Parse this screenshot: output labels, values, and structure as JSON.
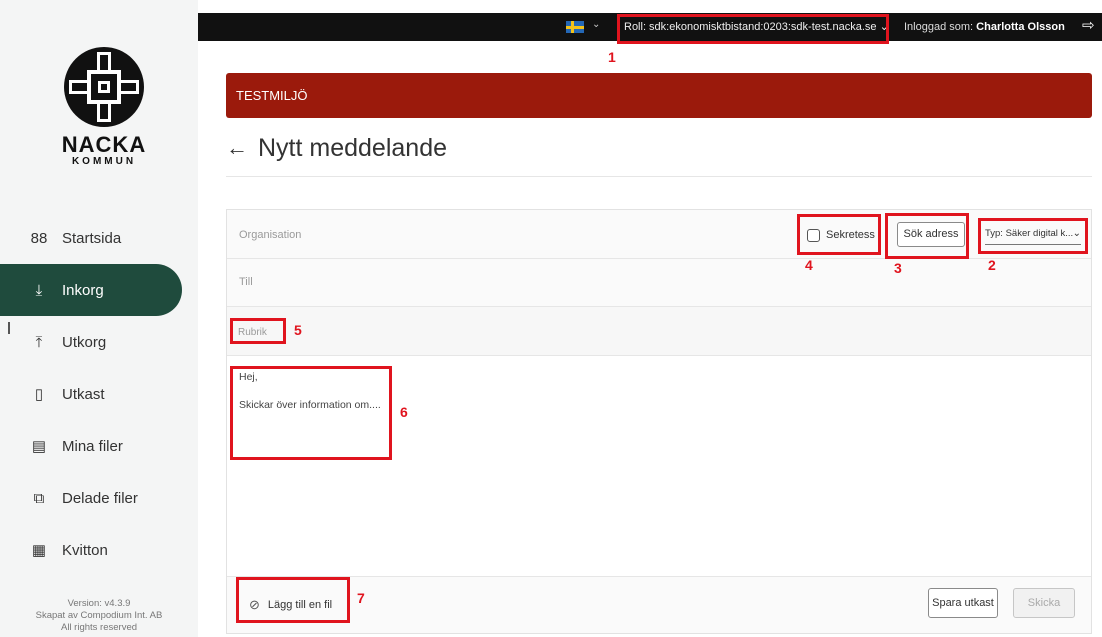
{
  "sidebar": {
    "logo": {
      "name": "NACKA",
      "sub": "KOMMUN"
    },
    "items": [
      {
        "label": "Startsida",
        "icon": "grid-icon",
        "glyph": "88"
      },
      {
        "label": "Inkorg",
        "icon": "inbox-icon",
        "glyph": "⤓",
        "active": true
      },
      {
        "label": "Utkorg",
        "icon": "outbox-icon",
        "glyph": "⤒"
      },
      {
        "label": "Utkast",
        "icon": "draft-icon",
        "glyph": "▯"
      },
      {
        "label": "Mina filer",
        "icon": "file-icon",
        "glyph": "▤"
      },
      {
        "label": "Delade filer",
        "icon": "shared-files-icon",
        "glyph": "⧉"
      },
      {
        "label": "Kvitton",
        "icon": "receipt-icon",
        "glyph": "▦"
      }
    ],
    "version": "Version: v4.3.9",
    "made_by": "Skapat av Compodium Int. AB",
    "rights": "All rights reserved"
  },
  "topbar": {
    "role": "Roll: sdk:ekonomisktbistand:0203:sdk-test.nacka.se",
    "role_caret": "⌄",
    "flag_caret": "⌄",
    "logged_in_label": "Inloggad som:",
    "user": "Charlotta Olsson",
    "logout_glyph": "⇨"
  },
  "banner": {
    "text": "TESTMILJÖ"
  },
  "page": {
    "back_glyph": "←",
    "title": "Nytt meddelande"
  },
  "form": {
    "organisation_placeholder": "Organisation",
    "to_placeholder": "Till",
    "subject_placeholder": "Rubrik",
    "secrecy_label": "Sekretess",
    "search_address_label": "Sök adress",
    "type_label": "Typ:",
    "type_value": "Säker digital k...",
    "type_caret": "⌄",
    "body_line1": "Hej,",
    "body_line2": "Skickar över information om....",
    "attach_label": "Lägg till en fil",
    "attach_glyph": "⊘",
    "save_draft_label": "Spara utkast",
    "send_label": "Skicka"
  },
  "annotations": [
    "1",
    "2",
    "3",
    "4",
    "5",
    "6",
    "7"
  ],
  "colors": {
    "sidebar_active": "#1f4b3d",
    "banner": "#9b1a0c",
    "annotation": "#e0141e",
    "topbar": "#111111"
  }
}
